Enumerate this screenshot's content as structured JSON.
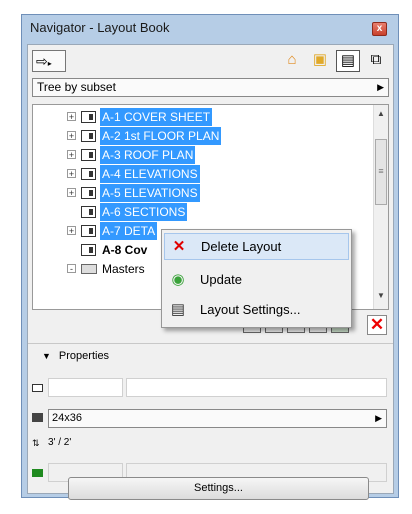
{
  "window": {
    "title": "Navigator - Layout Book",
    "close_symbol": "x"
  },
  "toolbar": {
    "nav_menu_icon": "⇨",
    "nav_menu_arrow": "▸",
    "modes": [
      {
        "name": "project-map-icon",
        "glyph": "⌂",
        "color": "#e08a1e"
      },
      {
        "name": "view-map-icon",
        "glyph": "▣",
        "color": "#e0a92a"
      },
      {
        "name": "layout-book-icon",
        "glyph": "▤",
        "color": "#222222"
      },
      {
        "name": "publisher-sets-icon",
        "glyph": "⧉",
        "color": "#222222"
      }
    ]
  },
  "tree_mode": {
    "value": "Tree by subset"
  },
  "tree": {
    "items": [
      {
        "label": "A-1 COVER SHEET",
        "selected": true,
        "expander": "+"
      },
      {
        "label": "A-2 1st FLOOR PLAN",
        "selected": true,
        "expander": "+"
      },
      {
        "label": "A-3 ROOF PLAN",
        "selected": true,
        "expander": "+"
      },
      {
        "label": "A-4 ELEVATIONS",
        "selected": true,
        "expander": "+"
      },
      {
        "label": "A-5 ELEVATIONS",
        "selected": true,
        "expander": "+"
      },
      {
        "label": "A-6 SECTIONS",
        "selected": true,
        "expander": ""
      },
      {
        "label": "A-7 DETA",
        "selected": true,
        "expander": "+"
      },
      {
        "label": "A-8 Cov",
        "selected": false,
        "expander": "",
        "bold": true
      },
      {
        "label": "Masters",
        "selected": false,
        "expander": "-",
        "folder": true
      }
    ]
  },
  "context_menu": {
    "items": [
      {
        "label": "Delete Layout",
        "icon": "✕",
        "icon_color": "#e00000",
        "hover": true
      },
      {
        "label": "Update",
        "icon": "◉",
        "icon_color": "#3aa33a",
        "hover": false
      },
      {
        "label": "Layout Settings...",
        "icon": "▤",
        "icon_color": "#333333",
        "hover": false
      }
    ]
  },
  "properties": {
    "header": "Properties",
    "size": "24x36",
    "scale": "3' / 2'",
    "settings_label": "Settings..."
  },
  "colors": {
    "selection": "#3399ff",
    "window_frame": "#b6cde6"
  }
}
